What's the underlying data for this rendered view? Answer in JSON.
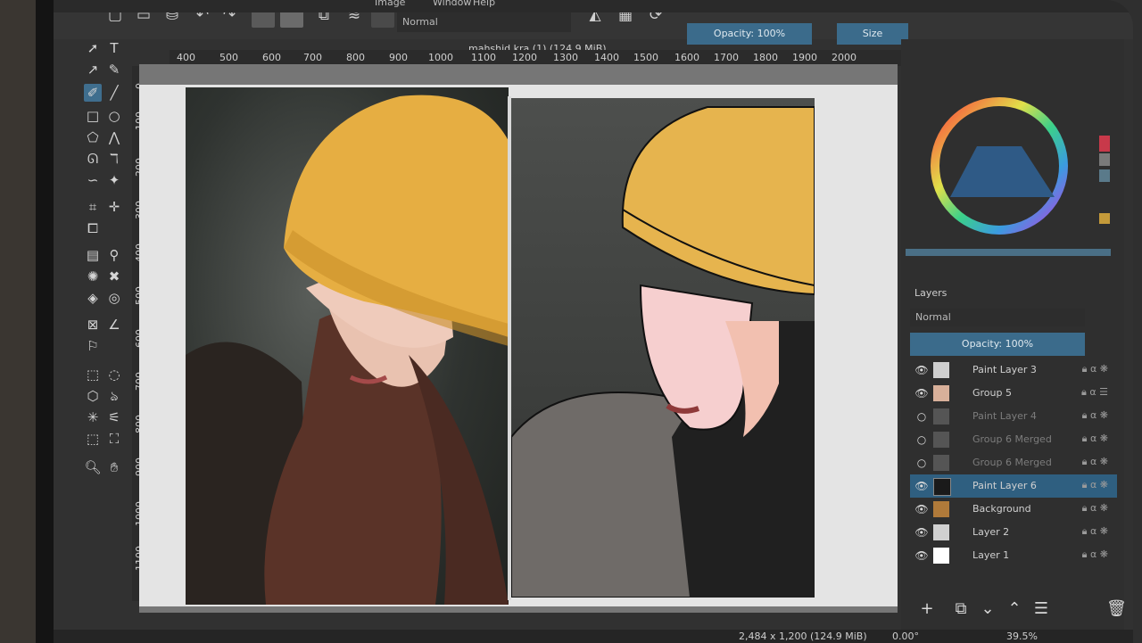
{
  "menu": {
    "items": [
      "Image",
      "Window",
      "Help"
    ]
  },
  "toolbar": {
    "blend_mode": "Normal",
    "opacity": "Opacity: 100%",
    "size": "Size"
  },
  "document": {
    "title": "mahshid.kra (1) (124.9 MiB)"
  },
  "ruler_top": [
    "400",
    "500",
    "600",
    "700",
    "800",
    "900",
    "1000",
    "1100",
    "1200",
    "1300",
    "1400",
    "1500",
    "1600",
    "1700",
    "1800",
    "1900",
    "2000"
  ],
  "ruler_left": [
    "0",
    "100",
    "200",
    "300",
    "400",
    "500",
    "600",
    "700",
    "800",
    "900",
    "1000",
    "1100"
  ],
  "layers": {
    "title": "Layers",
    "blend_mode": "Normal",
    "opacity": "Opacity:  100%",
    "items": [
      {
        "name": "Paint Layer 3",
        "visible": true,
        "selected": false
      },
      {
        "name": "Group 5",
        "visible": true,
        "selected": false
      },
      {
        "name": "Paint Layer 4",
        "visible": false,
        "selected": false
      },
      {
        "name": "Group 6 Merged",
        "visible": false,
        "selected": false
      },
      {
        "name": "Group 6 Merged",
        "visible": false,
        "selected": false
      },
      {
        "name": "Paint Layer 6",
        "visible": true,
        "selected": true
      },
      {
        "name": "Background",
        "visible": true,
        "selected": false
      },
      {
        "name": "Layer 2",
        "visible": true,
        "selected": false
      },
      {
        "name": "Layer 1",
        "visible": true,
        "selected": false
      }
    ]
  },
  "status": {
    "dimensions": "2,484 x 1,200 (124.9 MiB)",
    "rotation": "0.00°",
    "zoom": "39.5%"
  },
  "colors": {
    "accent": "#3b6b8b",
    "hat_yellow": "#e6b44e",
    "skin": "#f2c9c7"
  }
}
